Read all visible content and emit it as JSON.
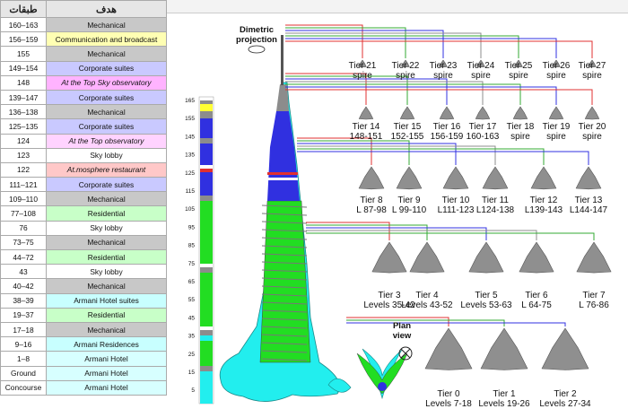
{
  "table": {
    "header_floors": "طبقات",
    "header_purpose": "هدف",
    "rows": [
      {
        "floors": "160–163",
        "purpose": "Mechanical",
        "cls": "c-mech"
      },
      {
        "floors": "156–159",
        "purpose": "Communication and broadcast",
        "cls": "c-comm"
      },
      {
        "floors": "155",
        "purpose": "Mechanical",
        "cls": "c-mech"
      },
      {
        "floors": "149–154",
        "purpose": "Corporate suites",
        "cls": "c-corp"
      },
      {
        "floors": "148",
        "purpose": "At the Top Sky observatory",
        "cls": "c-obs"
      },
      {
        "floors": "139–147",
        "purpose": "Corporate suites",
        "cls": "c-corp"
      },
      {
        "floors": "136–138",
        "purpose": "Mechanical",
        "cls": "c-mech"
      },
      {
        "floors": "125–135",
        "purpose": "Corporate suites",
        "cls": "c-corp"
      },
      {
        "floors": "124",
        "purpose": "At the Top observatory",
        "cls": "c-obs2"
      },
      {
        "floors": "123",
        "purpose": "Sky lobby",
        "cls": "c-sky"
      },
      {
        "floors": "122",
        "purpose": "At.mosphere restaurant",
        "cls": "c-rest"
      },
      {
        "floors": "111–121",
        "purpose": "Corporate suites",
        "cls": "c-corp"
      },
      {
        "floors": "109–110",
        "purpose": "Mechanical",
        "cls": "c-mech"
      },
      {
        "floors": "77–108",
        "purpose": "Residential",
        "cls": "c-res"
      },
      {
        "floors": "76",
        "purpose": "Sky lobby",
        "cls": "c-sky"
      },
      {
        "floors": "73–75",
        "purpose": "Mechanical",
        "cls": "c-mech"
      },
      {
        "floors": "44–72",
        "purpose": "Residential",
        "cls": "c-res"
      },
      {
        "floors": "43",
        "purpose": "Sky lobby",
        "cls": "c-sky"
      },
      {
        "floors": "40–42",
        "purpose": "Mechanical",
        "cls": "c-mech"
      },
      {
        "floors": "38–39",
        "purpose": "Armani Hotel suites",
        "cls": "c-arm"
      },
      {
        "floors": "19–37",
        "purpose": "Residential",
        "cls": "c-res"
      },
      {
        "floors": "17–18",
        "purpose": "Mechanical",
        "cls": "c-mech"
      },
      {
        "floors": "9–16",
        "purpose": "Armani Residences",
        "cls": "c-arm"
      },
      {
        "floors": "1–8",
        "purpose": "Armani Hotel",
        "cls": "c-armw"
      },
      {
        "floors": "Ground",
        "purpose": "Armani Hotel",
        "cls": "c-armw"
      },
      {
        "floors": "Concourse",
        "purpose": "Armani Hotel",
        "cls": "c-armw"
      }
    ]
  },
  "diagram": {
    "dimetric_label_1": "Dimetric",
    "dimetric_label_2": "projection",
    "plan_label_1": "Plan",
    "plan_label_2": "view",
    "scale_ticks": [
      "165",
      "155",
      "145",
      "135",
      "125",
      "115",
      "105",
      "95",
      "85",
      "75",
      "65",
      "55",
      "45",
      "35",
      "25",
      "15",
      "5"
    ],
    "spires": [
      {
        "a": "Tier 21",
        "b": "spire"
      },
      {
        "a": "Tier 22",
        "b": "spire"
      },
      {
        "a": "Tier 23",
        "b": "spire"
      },
      {
        "a": "Tier 24",
        "b": "spire"
      },
      {
        "a": "Tier 25",
        "b": "spire"
      },
      {
        "a": "Tier 26",
        "b": "spire"
      },
      {
        "a": "Tier 27",
        "b": "spire"
      }
    ],
    "row2": [
      {
        "a": "Tier 14",
        "b": "148-151"
      },
      {
        "a": "Tier 15",
        "b": "152-155"
      },
      {
        "a": "Tier 16",
        "b": "156-159"
      },
      {
        "a": "Tier 17",
        "b": "160-163"
      },
      {
        "a": "Tier 18",
        "b": "spire"
      },
      {
        "a": "Tier 19",
        "b": "spire"
      },
      {
        "a": "Tier 20",
        "b": "spire"
      }
    ],
    "row3": [
      {
        "a": "Tier 8",
        "b": "L 87-98"
      },
      {
        "a": "Tier 9",
        "b": "L 99-110"
      },
      {
        "a": "Tier 10",
        "b": "L111-123"
      },
      {
        "a": "Tier 11",
        "b": "L124-138"
      },
      {
        "a": "Tier 12",
        "b": "L139-143"
      },
      {
        "a": "Tier 13",
        "b": "L144-147"
      }
    ],
    "row4": [
      {
        "a": "Tier 3",
        "b": "Levels 35-42"
      },
      {
        "a": "Tier 4",
        "b": "Levels 43-52"
      },
      {
        "a": "Tier 5",
        "b": "Levels 53-63"
      },
      {
        "a": "Tier 6",
        "b": "L 64-75"
      },
      {
        "a": "Tier 7",
        "b": "L 76-86"
      }
    ],
    "row5": [
      {
        "a": "Tier 0",
        "b": "Levels 7-18"
      },
      {
        "a": "Tier 1",
        "b": "Levels 19-26"
      },
      {
        "a": "Tier 2",
        "b": "Levels 27-34"
      }
    ],
    "colors": {
      "blue": "#3030e0",
      "green": "#22dd22",
      "grey": "#8c8c8c",
      "cyan": "#22eeee",
      "red": "#e03030"
    }
  }
}
